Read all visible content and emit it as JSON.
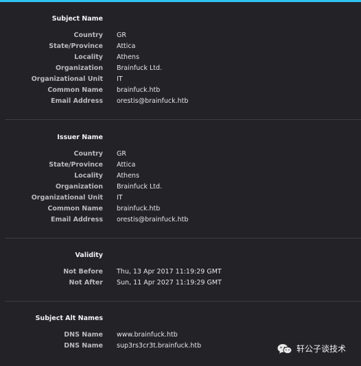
{
  "subject": {
    "title": "Subject Name",
    "fields": [
      {
        "label": "Country",
        "value": "GR"
      },
      {
        "label": "State/Province",
        "value": "Attica"
      },
      {
        "label": "Locality",
        "value": "Athens"
      },
      {
        "label": "Organization",
        "value": "Brainfuck Ltd."
      },
      {
        "label": "Organizational Unit",
        "value": "IT"
      },
      {
        "label": "Common Name",
        "value": "brainfuck.htb"
      },
      {
        "label": "Email Address",
        "value": "orestis@brainfuck.htb"
      }
    ]
  },
  "issuer": {
    "title": "Issuer Name",
    "fields": [
      {
        "label": "Country",
        "value": "GR"
      },
      {
        "label": "State/Province",
        "value": "Attica"
      },
      {
        "label": "Locality",
        "value": "Athens"
      },
      {
        "label": "Organization",
        "value": "Brainfuck Ltd."
      },
      {
        "label": "Organizational Unit",
        "value": "IT"
      },
      {
        "label": "Common Name",
        "value": "brainfuck.htb"
      },
      {
        "label": "Email Address",
        "value": "orestis@brainfuck.htb"
      }
    ]
  },
  "validity": {
    "title": "Validity",
    "fields": [
      {
        "label": "Not Before",
        "value": "Thu, 13 Apr 2017 11:19:29 GMT"
      },
      {
        "label": "Not After",
        "value": "Sun, 11 Apr 2027 11:19:29 GMT"
      }
    ]
  },
  "alt_names": {
    "title": "Subject Alt Names",
    "fields": [
      {
        "label": "DNS Name",
        "value": "www.brainfuck.htb"
      },
      {
        "label": "DNS Name",
        "value": "sup3rs3cr3t.brainfuck.htb"
      }
    ]
  },
  "watermark": {
    "text": "轩公子谈技术",
    "icon": "wechat-icon"
  },
  "colors": {
    "background": "#232327",
    "accent": "#2ec4f1",
    "label": "#b9b9c0",
    "value": "#e6e6ea"
  }
}
